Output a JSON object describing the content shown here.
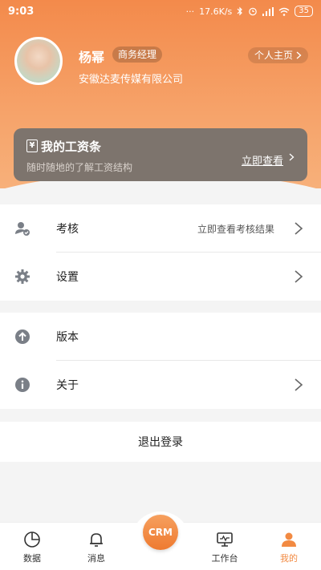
{
  "status": {
    "time": "9:03",
    "network_speed": "17.6K/s",
    "battery": "35"
  },
  "profile": {
    "name": "杨幂",
    "role": "商务经理",
    "company": "安徽达麦传媒有限公司",
    "home_link": "个人主页"
  },
  "salary": {
    "title": "我的工资条",
    "subtitle": "随时随地的了解工资结构",
    "action": "立即查看",
    "icon_glyph": "¥"
  },
  "menu": {
    "group1": [
      {
        "label": "考核",
        "right": "立即查看考核结果",
        "icon": "user-check-icon",
        "chevron": true
      },
      {
        "label": "设置",
        "right": "",
        "icon": "gear-icon",
        "chevron": true
      }
    ],
    "group2": [
      {
        "label": "版本",
        "right": "",
        "icon": "arrow-up-circle-icon",
        "chevron": false
      },
      {
        "label": "关于",
        "right": "",
        "icon": "info-circle-icon",
        "chevron": true
      }
    ],
    "logout": "退出登录"
  },
  "nav": {
    "items": [
      {
        "label": "数据",
        "icon": "pie-chart-icon",
        "active": false
      },
      {
        "label": "消息",
        "icon": "bell-icon",
        "active": false
      },
      {
        "label": "CRM",
        "icon": "crm-icon",
        "active": false
      },
      {
        "label": "工作台",
        "icon": "monitor-icon",
        "active": false
      },
      {
        "label": "我的",
        "icon": "person-icon",
        "active": true
      }
    ],
    "active_color": "#f28a42"
  },
  "colors": {
    "accent": "#f38a4b",
    "card": "#7d746d",
    "icon_gray": "#7a7f87"
  }
}
